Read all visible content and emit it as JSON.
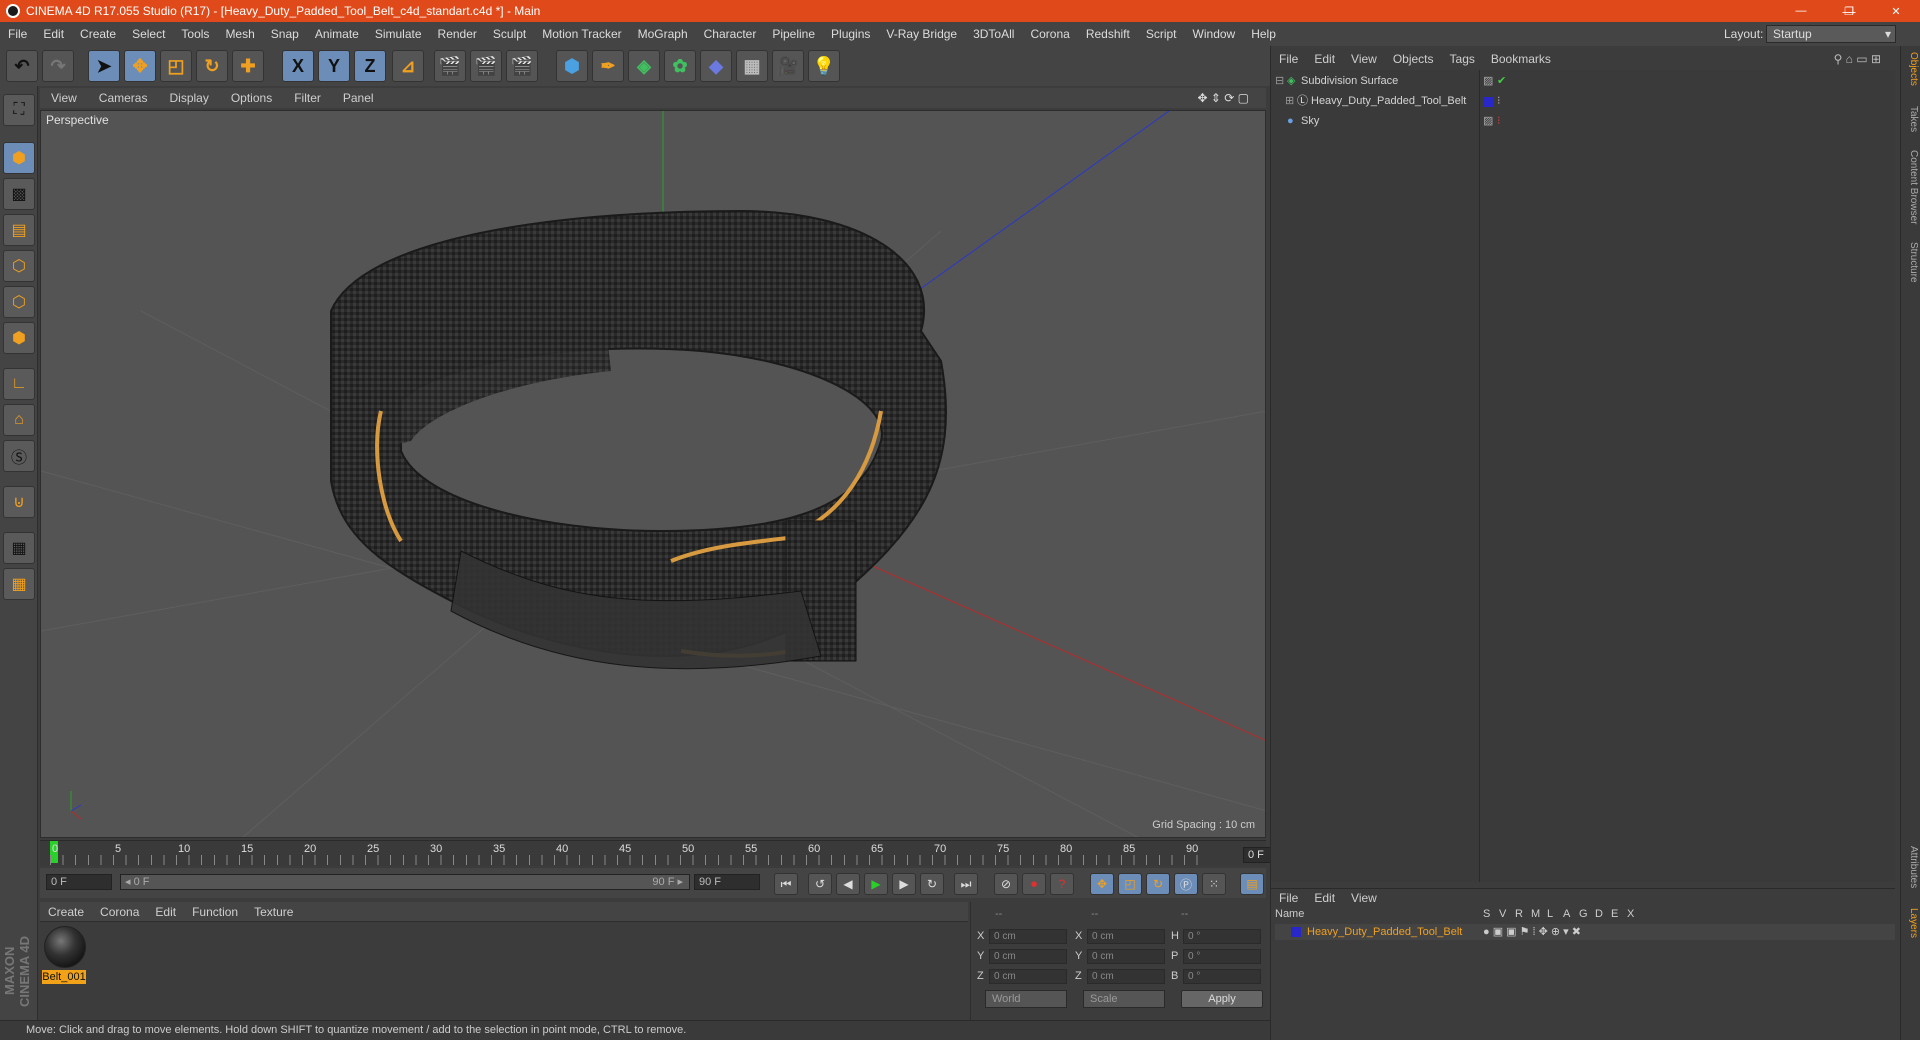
{
  "window": {
    "title": "CINEMA 4D R17.055 Studio (R17) - [Heavy_Duty_Padded_Tool_Belt_c4d_standart.c4d *] - Main",
    "minimize": "—",
    "restore": "❐",
    "close": "✕"
  },
  "menubar": {
    "items": [
      "File",
      "Edit",
      "Create",
      "Select",
      "Tools",
      "Mesh",
      "Snap",
      "Animate",
      "Simulate",
      "Render",
      "Sculpt",
      "Motion Tracker",
      "MoGraph",
      "Character",
      "Pipeline",
      "Plugins",
      "V-Ray Bridge",
      "3DToAll",
      "Corona",
      "Redshift",
      "Script",
      "Window",
      "Help"
    ],
    "layout_label": "Layout:",
    "layout_value": "Startup"
  },
  "toolbar": {
    "axis_x": "X",
    "axis_y": "Y",
    "axis_z": "Z"
  },
  "viewport": {
    "menu": [
      "View",
      "Cameras",
      "Display",
      "Options",
      "Filter",
      "Panel"
    ],
    "label": "Perspective",
    "grid_spacing": "Grid Spacing : 10 cm"
  },
  "timeline": {
    "ticks": [
      "0",
      "5",
      "10",
      "15",
      "20",
      "25",
      "30",
      "35",
      "40",
      "45",
      "50",
      "55",
      "60",
      "65",
      "70",
      "75",
      "80",
      "85",
      "90"
    ],
    "current_frame": "0 F",
    "start_field": "0 F",
    "range_start": "◂ 0 F",
    "range_end": "90 F ▸",
    "end_field": "90 F"
  },
  "material_manager": {
    "menu": [
      "Create",
      "Corona",
      "Edit",
      "Function",
      "Texture"
    ],
    "materials": [
      {
        "name": "Belt_001"
      }
    ]
  },
  "attributes": {
    "header": [
      "--",
      "--",
      "--"
    ],
    "rows": [
      {
        "a": "X",
        "v1": "0 cm",
        "b": "X",
        "v2": "0 cm",
        "c": "H",
        "v3": "0 °"
      },
      {
        "a": "Y",
        "v1": "0 cm",
        "b": "Y",
        "v2": "0 cm",
        "c": "P",
        "v3": "0 °"
      },
      {
        "a": "Z",
        "v1": "0 cm",
        "b": "Z",
        "v2": "0 cm",
        "c": "B",
        "v3": "0 °"
      }
    ],
    "coord_system": "World",
    "mode": "Scale",
    "apply": "Apply"
  },
  "status": "Move: Click and drag to move elements. Hold down SHIFT to quantize movement / add to the selection in point mode, CTRL to remove.",
  "brand": "MAXON CINEMA 4D",
  "object_manager": {
    "menu": [
      "File",
      "Edit",
      "View",
      "Objects",
      "Tags",
      "Bookmarks"
    ],
    "objects": [
      {
        "name": "Subdivision Surface"
      },
      {
        "name": "Heavy_Duty_Padded_Tool_Belt"
      },
      {
        "name": "Sky"
      }
    ]
  },
  "layer_manager": {
    "menu": [
      "File",
      "Edit",
      "View"
    ],
    "columns": [
      "Name",
      "S",
      "V",
      "R",
      "M",
      "L",
      "A",
      "G",
      "D",
      "E",
      "X"
    ],
    "layers": [
      {
        "name": "Heavy_Duty_Padded_Tool_Belt"
      }
    ]
  },
  "side_tabs": [
    "Objects",
    "Takes",
    "Content Browser",
    "Structure",
    "Attributes",
    "Layers"
  ],
  "colors": {
    "title_bar": "#e04a1a",
    "accent": "#f2a218",
    "layer_color": "#2828c8"
  }
}
